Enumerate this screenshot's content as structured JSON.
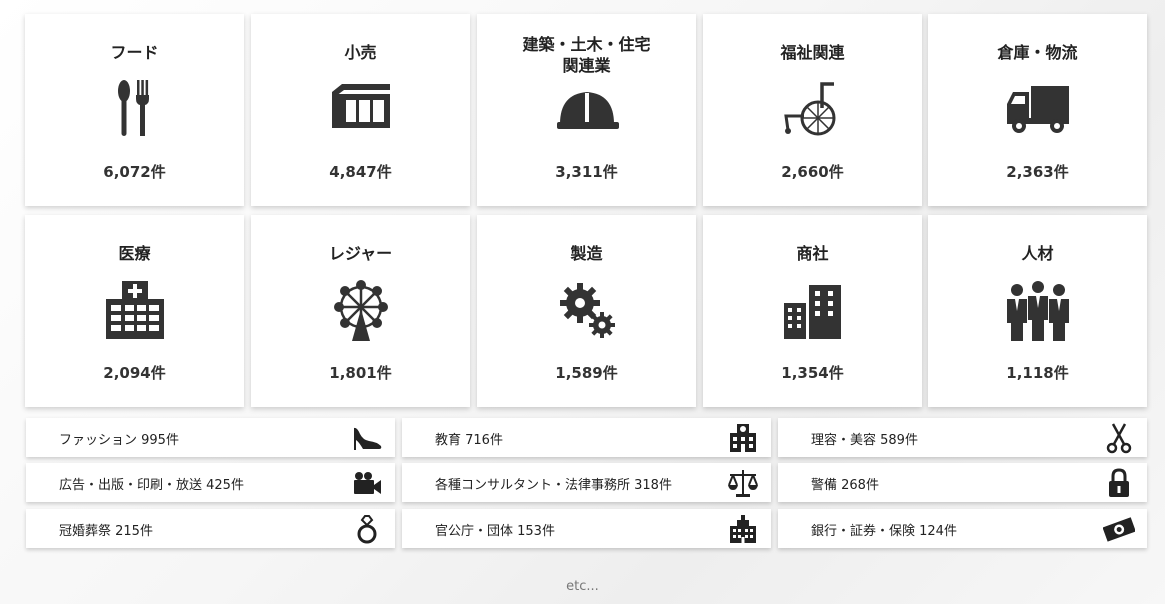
{
  "tiles": [
    {
      "label": "フード",
      "count": "6,072件",
      "icon": "fork-spoon-icon"
    },
    {
      "label": "小売",
      "count": "4,847件",
      "icon": "storefront-icon"
    },
    {
      "label": "建築・土木・住宅\n関連業",
      "count": "3,311件",
      "icon": "hard-hat-icon"
    },
    {
      "label": "福祉関連",
      "count": "2,660件",
      "icon": "wheelchair-icon"
    },
    {
      "label": "倉庫・物流",
      "count": "2,363件",
      "icon": "truck-icon"
    },
    {
      "label": "医療",
      "count": "2,094件",
      "icon": "hospital-icon"
    },
    {
      "label": "レジャー",
      "count": "1,801件",
      "icon": "ferris-wheel-icon"
    },
    {
      "label": "製造",
      "count": "1,589件",
      "icon": "gears-icon"
    },
    {
      "label": "商社",
      "count": "1,354件",
      "icon": "office-buildings-icon"
    },
    {
      "label": "人材",
      "count": "1,118件",
      "icon": "people-icon"
    }
  ],
  "rows": [
    {
      "label": "ファッション 995件",
      "icon": "high-heel-icon"
    },
    {
      "label": "教育 716件",
      "icon": "school-icon"
    },
    {
      "label": "理容・美容 589件",
      "icon": "scissors-icon"
    },
    {
      "label": "広告・出版・印刷・放送 425件",
      "icon": "video-camera-icon"
    },
    {
      "label": "各種コンサルタント・法律事務所 318件",
      "icon": "scales-icon"
    },
    {
      "label": "警備 268件",
      "icon": "padlock-icon"
    },
    {
      "label": "冠婚葬祭 215件",
      "icon": "ring-icon"
    },
    {
      "label": "官公庁・団体 153件",
      "icon": "government-building-icon"
    },
    {
      "label": "銀行・証券・保険 124件",
      "icon": "banknote-icon"
    }
  ],
  "footer": {
    "etc": "etc..."
  },
  "colors": {
    "icon": "#333333",
    "tile_bg": "#ffffff"
  }
}
